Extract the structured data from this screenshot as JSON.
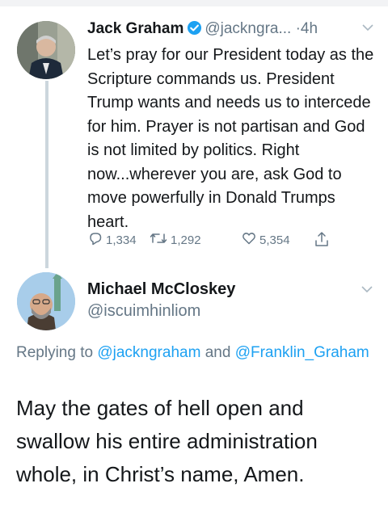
{
  "tweet1": {
    "author_name": "Jack Graham",
    "handle": "@jackngra...",
    "separator": "·",
    "time": "4h",
    "body": "Let’s pray for our President today as the Scripture commands us. President Trump wants and needs us to intercede for him. Prayer is not partisan and God is not limited by politics. Right now...wherever you are, ask God to move powerfully in Donald Trumps heart.",
    "reply_count": "1,334",
    "retweet_count": "1,292",
    "like_count": "5,354"
  },
  "tweet2": {
    "author_name": "Michael McCloskey",
    "handle": "@iscuimhinliom",
    "replying_prefix": "Replying to",
    "replying_handle_1": "@jackngraham",
    "replying_and": "and",
    "replying_handle_2": "@Franklin_Graham",
    "body": "May the gates of hell open and swallow his entire administration whole, in Christ’s name, Amen."
  },
  "icons": {
    "verified": "verified-badge-icon",
    "reply": "reply-icon",
    "retweet": "retweet-icon",
    "like": "like-icon",
    "share": "share-icon",
    "more": "chevron-down-icon"
  },
  "colors": {
    "link": "#1da1f2",
    "secondary_text": "#657786",
    "primary_text": "#14171a",
    "thread_line": "#ccd6dd"
  }
}
